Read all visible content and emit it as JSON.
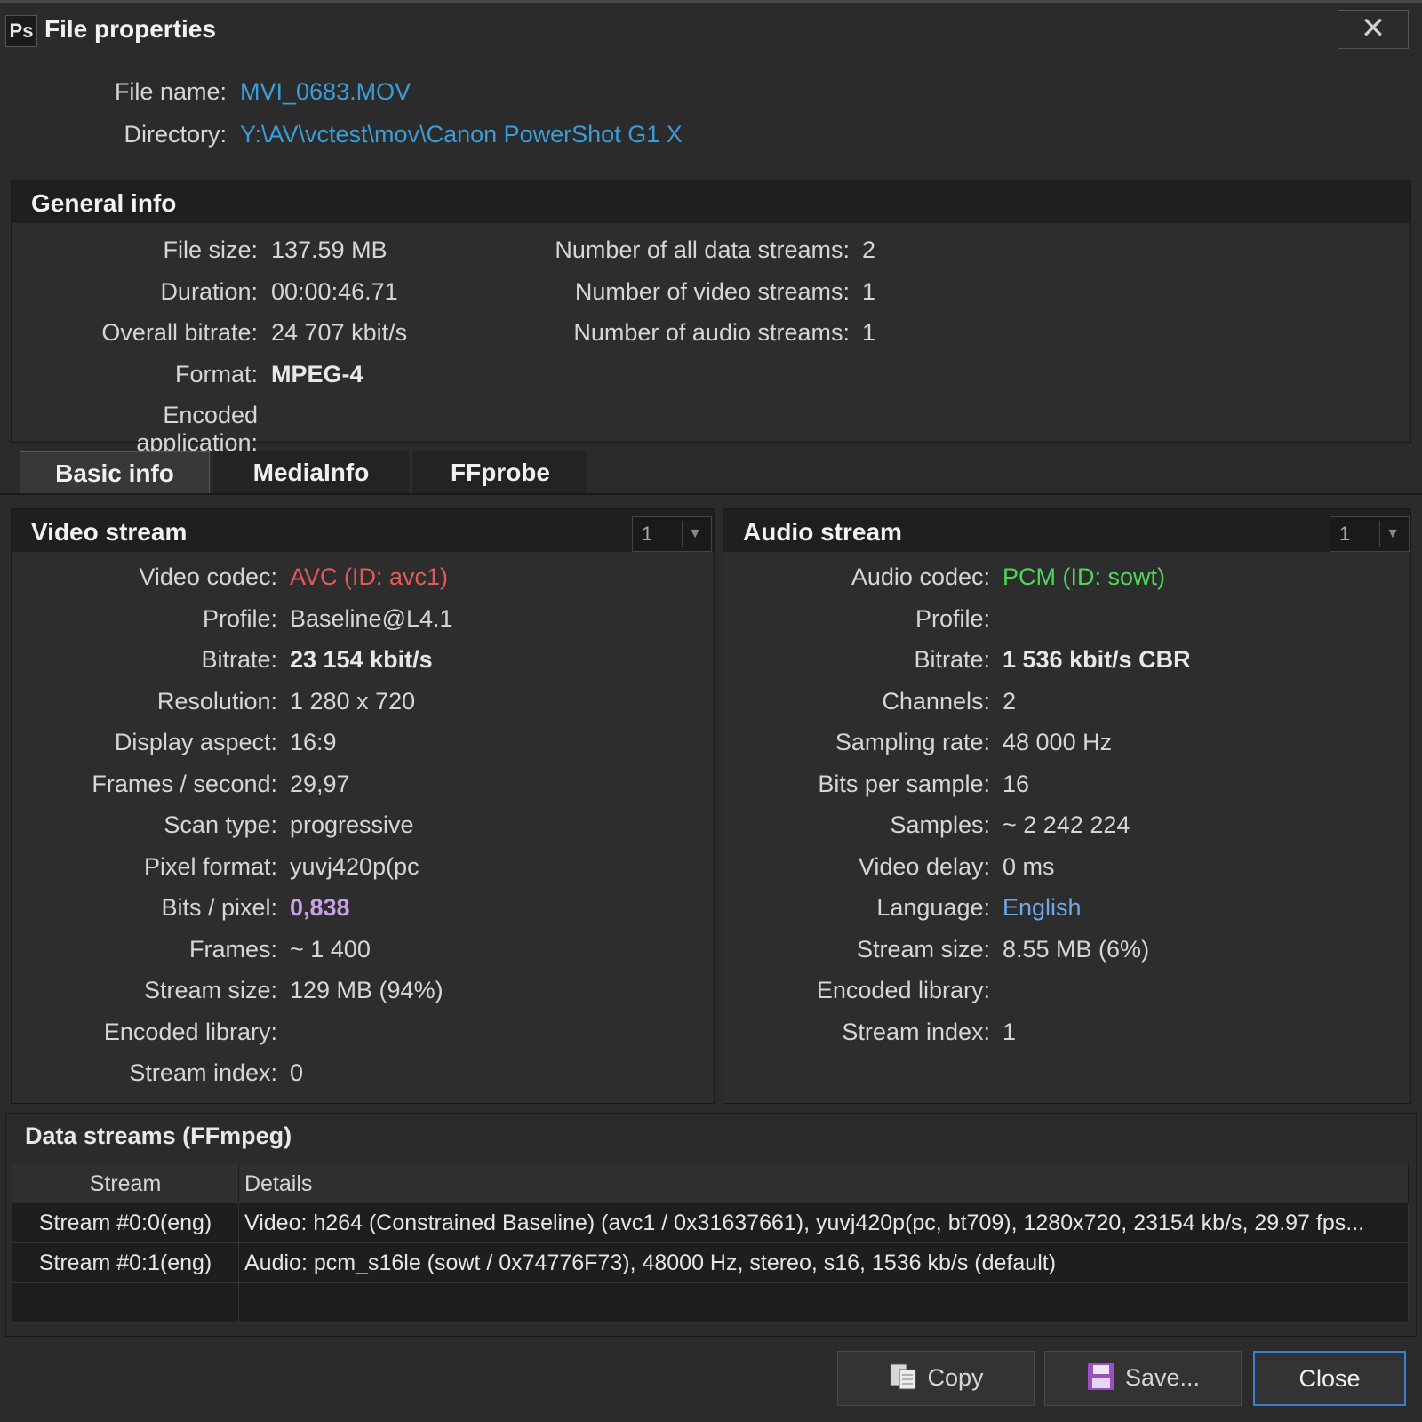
{
  "window": {
    "title": "File properties",
    "app_icon": "Ps",
    "close_icon": "close-icon"
  },
  "file": {
    "name_label": "File name:",
    "name_value": "MVI_0683.MOV",
    "dir_label": "Directory:",
    "dir_value": "Y:\\AV\\vctest\\mov\\Canon PowerShot G1 X"
  },
  "general": {
    "title": "General info",
    "left": [
      {
        "label": "File size:",
        "value": "137.59 MB"
      },
      {
        "label": "Duration:",
        "value": "00:00:46.71"
      },
      {
        "label": "Overall bitrate:",
        "value": "24 707 kbit/s"
      },
      {
        "label": "Format:",
        "value": "MPEG-4"
      },
      {
        "label": "Encoded application:",
        "value": ""
      }
    ],
    "right": [
      {
        "label": "Number of all data streams:",
        "value": "2"
      },
      {
        "label": "Number of video streams:",
        "value": "1"
      },
      {
        "label": "Number of audio streams:",
        "value": "1"
      }
    ]
  },
  "tabs": [
    "Basic info",
    "MediaInfo",
    "FFprobe"
  ],
  "video": {
    "title": "Video stream",
    "selector": "1",
    "rows": [
      {
        "label": "Video codec:",
        "value": "AVC (ID: avc1)"
      },
      {
        "label": "Profile:",
        "value": "Baseline@L4.1"
      },
      {
        "label": "Bitrate:",
        "value": "23 154 kbit/s"
      },
      {
        "label": "Resolution:",
        "value": "1 280 x 720"
      },
      {
        "label": "Display aspect:",
        "value": "16:9"
      },
      {
        "label": "Frames / second:",
        "value": "29,97"
      },
      {
        "label": "Scan type:",
        "value": "progressive"
      },
      {
        "label": "Pixel format:",
        "value": "yuvj420p(pc"
      },
      {
        "label": "Bits / pixel:",
        "value": "0,838"
      },
      {
        "label": "Frames:",
        "value": "~ 1 400"
      },
      {
        "label": "Stream size:",
        "value": "129 MB (94%)"
      },
      {
        "label": "Encoded library:",
        "value": ""
      },
      {
        "label": "Stream index:",
        "value": "0"
      }
    ]
  },
  "audio": {
    "title": "Audio stream",
    "selector": "1",
    "rows": [
      {
        "label": "Audio codec:",
        "value": "PCM (ID: sowt)"
      },
      {
        "label": "Profile:",
        "value": ""
      },
      {
        "label": "Bitrate:",
        "value": "1 536 kbit/s  CBR"
      },
      {
        "label": "Channels:",
        "value": "2"
      },
      {
        "label": "Sampling rate:",
        "value": "48 000 Hz"
      },
      {
        "label": "Bits per sample:",
        "value": "16"
      },
      {
        "label": "Samples:",
        "value": "~ 2 242 224"
      },
      {
        "label": "Video delay:",
        "value": "0 ms"
      },
      {
        "label": "Language:",
        "value": "English"
      },
      {
        "label": "Stream size:",
        "value": "8.55 MB (6%)"
      },
      {
        "label": "Encoded library:",
        "value": ""
      },
      {
        "label": "Stream index:",
        "value": "1"
      }
    ]
  },
  "data_streams": {
    "title": "Data streams   (FFmpeg)",
    "headers": [
      "Stream",
      "Details"
    ],
    "rows": [
      [
        "Stream #0:0(eng)",
        "Video: h264 (Constrained Baseline) (avc1 / 0x31637661), yuvj420p(pc, bt709), 1280x720, 23154 kb/s, 29.97 fps..."
      ],
      [
        "Stream #0:1(eng)",
        "Audio: pcm_s16le (sowt / 0x74776F73), 48000 Hz, stereo, s16, 1536 kb/s (default)"
      ]
    ]
  },
  "buttons": {
    "copy": "Copy",
    "save": "Save...",
    "close": "Close"
  }
}
